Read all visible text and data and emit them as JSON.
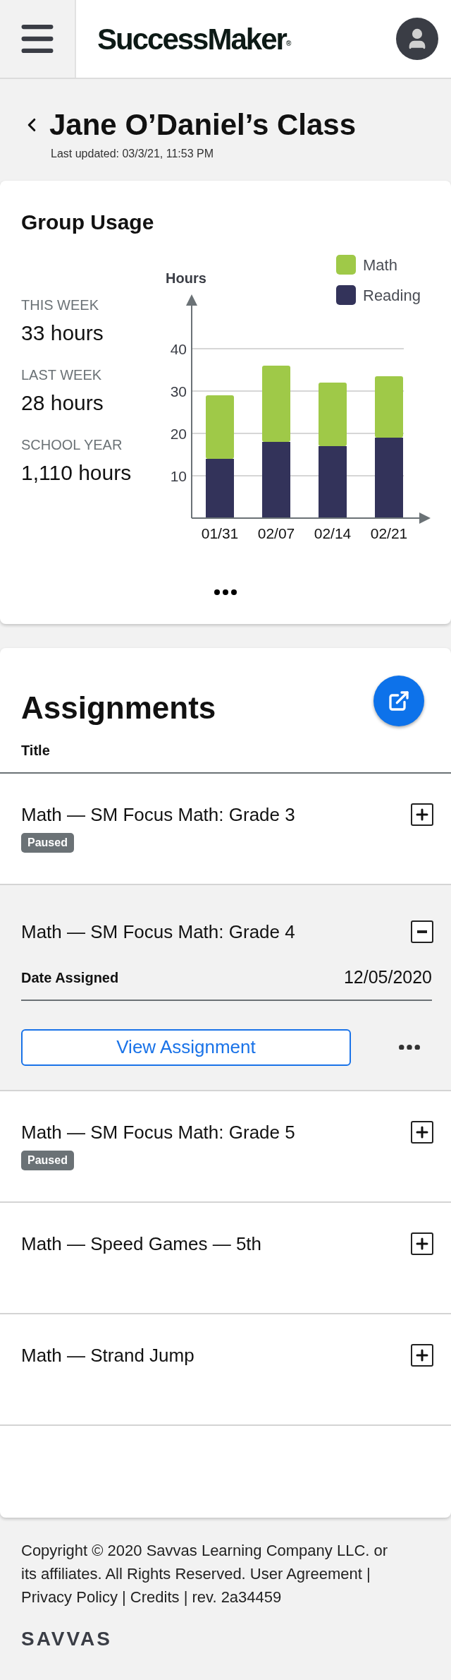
{
  "header": {
    "logo": "SuccessMaker",
    "logo_mark": "®"
  },
  "page": {
    "title": "Jane O’Daniel’s Class",
    "updated": "Last updated: 03/3/21, 11:53 PM"
  },
  "usage": {
    "title": "Group Usage",
    "stats": [
      {
        "label": "THIS WEEK",
        "value": "33 hours"
      },
      {
        "label": "LAST WEEK",
        "value": "28 hours"
      },
      {
        "label": "SCHOOL YEAR",
        "value": "1,110 hours"
      }
    ],
    "chart_data": {
      "type": "bar",
      "stacked": true,
      "grid": true,
      "legend": true,
      "ylabel": "Hours",
      "categories": [
        "01/31",
        "02/07",
        "02/14",
        "02/21"
      ],
      "yticks": [
        10,
        20,
        30,
        40
      ],
      "ylim": [
        0,
        40
      ],
      "series": [
        {
          "name": "Math",
          "color": "#9fc948",
          "values": [
            15,
            18,
            15,
            14.5
          ]
        },
        {
          "name": "Reading",
          "color": "#33335a",
          "values": [
            14,
            18,
            17,
            19
          ]
        }
      ]
    }
  },
  "assignments": {
    "title": "Assignments",
    "column": "Title",
    "rows": [
      {
        "title": "Math — SM Focus Math: Grade 3",
        "status": "Paused",
        "expanded": false
      },
      {
        "title": "Math — SM Focus Math: Grade 4",
        "expanded": true,
        "detail_label": "Date Assigned",
        "detail_value": "12/05/2020",
        "action": "View Assignment"
      },
      {
        "title": "Math — SM Focus Math: Grade 5",
        "status": "Paused",
        "expanded": false
      },
      {
        "title": "Math — Speed Games — 5th",
        "expanded": false
      },
      {
        "title": "Math — Strand Jump",
        "expanded": false
      }
    ]
  },
  "footer": {
    "text": "Copyright © 2020 Savvas Learning Company LLC. or its affiliates. All Rights Reserved. User Agreement | Privacy Policy | Credits | rev. 2a34459",
    "brand": "SAVVAS"
  }
}
